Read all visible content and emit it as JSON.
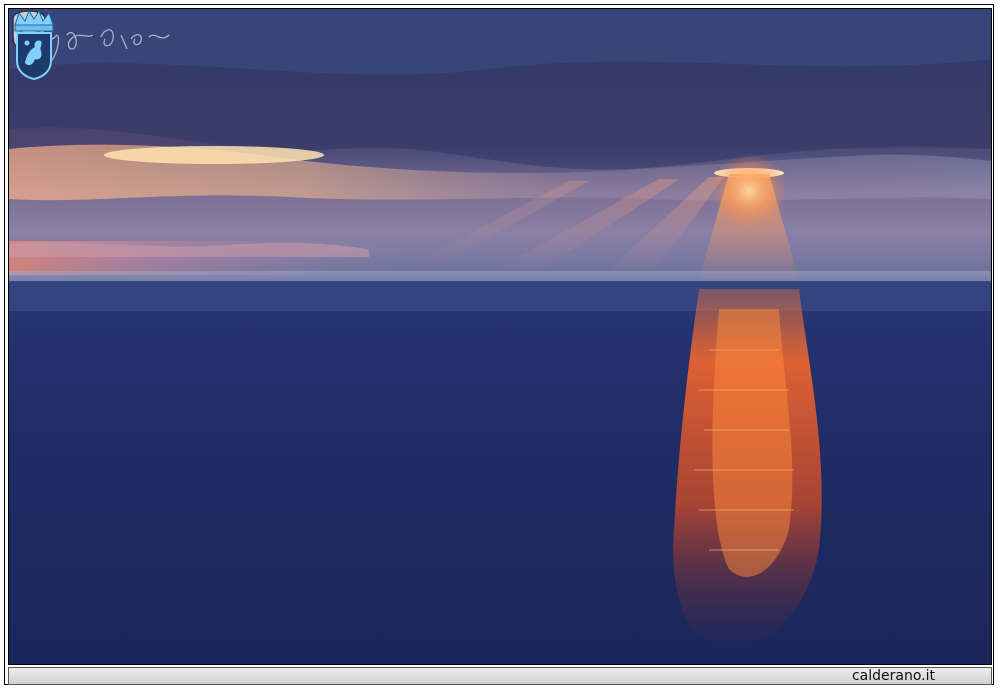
{
  "footer": {
    "site_label": "calderano.it"
  },
  "icons": {
    "left_crest": "coat-of-arms-icon",
    "right_crest": "crowned-shield-icon",
    "signature": "handwritten-signature"
  },
  "colors": {
    "sky": "#4a5a8c",
    "sea": "#1e2b63",
    "sunlight": "#ff7a2a",
    "crest_blue": "#7fd0ff"
  }
}
